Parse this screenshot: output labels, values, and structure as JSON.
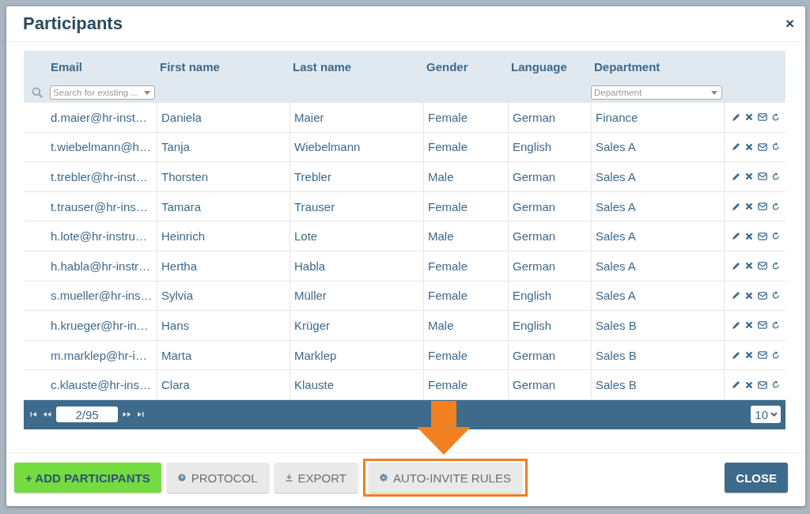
{
  "dialog": {
    "title": "Participants",
    "close": "×"
  },
  "table": {
    "columns": [
      {
        "label": "Email",
        "filter": {
          "kind": "search",
          "placeholder": "Search for existing ..."
        }
      },
      {
        "label": "First name"
      },
      {
        "label": "Last name"
      },
      {
        "label": "Gender"
      },
      {
        "label": "Language"
      },
      {
        "label": "Department",
        "filter": {
          "kind": "select",
          "placeholder": "Department"
        }
      }
    ],
    "rows": [
      {
        "email": "d.maier@hr-inst…",
        "first_name": "Daniela",
        "last_name": "Maier",
        "gender": "Female",
        "language": "German",
        "department": "Finance"
      },
      {
        "email": "t.wiebelmann@h…",
        "first_name": "Tanja",
        "last_name": "Wiebelmann",
        "gender": "Female",
        "language": "English",
        "department": "Sales A"
      },
      {
        "email": "t.trebler@hr-inst…",
        "first_name": "Thorsten",
        "last_name": "Trebler",
        "gender": "Male",
        "language": "German",
        "department": "Sales A"
      },
      {
        "email": "t.trauser@hr-ins…",
        "first_name": "Tamara",
        "last_name": "Trauser",
        "gender": "Female",
        "language": "German",
        "department": "Sales A"
      },
      {
        "email": "h.lote@hr-instru…",
        "first_name": "Heinrich",
        "last_name": "Lote",
        "gender": "Male",
        "language": "German",
        "department": "Sales A"
      },
      {
        "email": "h.habla@hr-instr…",
        "first_name": "Hertha",
        "last_name": "Habla",
        "gender": "Female",
        "language": "German",
        "department": "Sales A"
      },
      {
        "email": "s.mueller@hr-ins…",
        "first_name": "Sylvia",
        "last_name": "Müller",
        "gender": "Female",
        "language": "English",
        "department": "Sales A"
      },
      {
        "email": "h.krueger@hr-in…",
        "first_name": "Hans",
        "last_name": "Krüger",
        "gender": "Male",
        "language": "English",
        "department": "Sales B"
      },
      {
        "email": "m.marklep@hr-i…",
        "first_name": "Marta",
        "last_name": "Marklep",
        "gender": "Female",
        "language": "German",
        "department": "Sales B"
      },
      {
        "email": "c.klauste@hr-ins…",
        "first_name": "Clara",
        "last_name": "Klauste",
        "gender": "Female",
        "language": "German",
        "department": "Sales B"
      }
    ]
  },
  "pager": {
    "page": "2/95",
    "page_size": "10"
  },
  "buttons": [
    {
      "kind": "primary",
      "label": "+ ADD PARTICIPANTS",
      "highlighted": false
    },
    {
      "kind": "secondary",
      "label": "PROTOCOL",
      "highlighted": false
    },
    {
      "kind": "secondary",
      "label": "EXPORT",
      "highlighted": false
    },
    {
      "kind": "secondary",
      "label": "AUTO-INVITE RULES",
      "highlighted": true
    },
    {
      "kind": "close",
      "label": "CLOSE",
      "highlighted": false
    }
  ]
}
